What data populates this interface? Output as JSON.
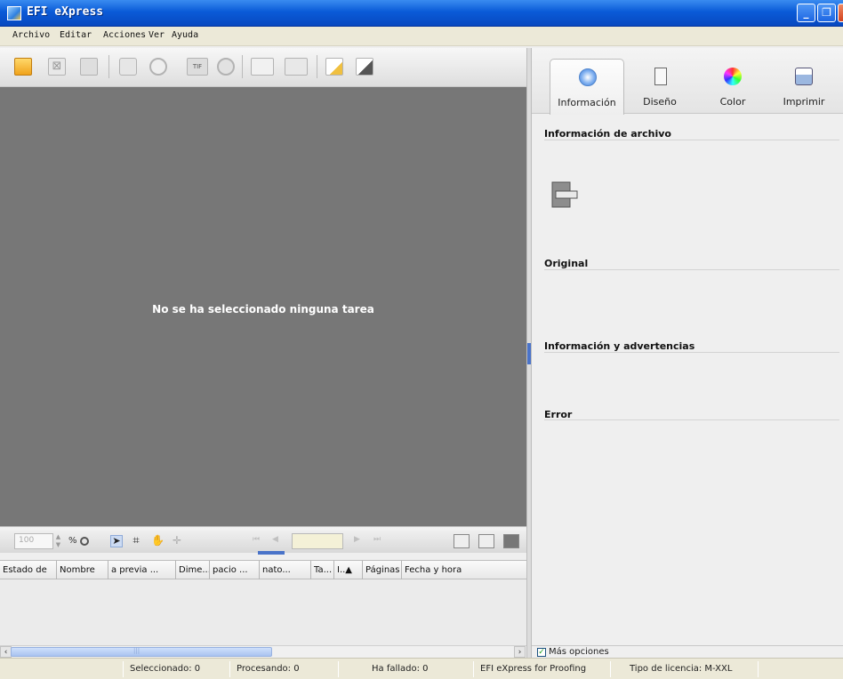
{
  "window": {
    "title": "EFI eXpress"
  },
  "menu": [
    "Archivo",
    "Editar",
    "Acciones",
    "Ver",
    "Ayuda"
  ],
  "preview": {
    "message": "No se ha seleccionado ninguna tarea"
  },
  "viewbar": {
    "zoom_value": "100",
    "zoom_unit": "%"
  },
  "table": {
    "columns": [
      "Estado de",
      "Nombre",
      "a previa ...",
      "Dime...",
      "pacio ...",
      "nato...",
      "Ta...",
      "I..▲",
      "Páginas",
      "Fecha y hora"
    ]
  },
  "right_panel": {
    "tabs": [
      {
        "label": "Información",
        "icon": "info-icon"
      },
      {
        "label": "Diseño",
        "icon": "layout-icon"
      },
      {
        "label": "Color",
        "icon": "color-wheel-icon"
      },
      {
        "label": "Imprimir",
        "icon": "printer-icon"
      }
    ],
    "sections": [
      "Información de archivo",
      "Original",
      "Información y advertencias",
      "Error"
    ],
    "more_options": "Más opciones"
  },
  "status": {
    "selected": "Seleccionado: 0",
    "processing": "Procesando: 0",
    "failed": "Ha fallado: 0",
    "product": "EFI eXpress for Proofing",
    "license": "Tipo de licencia: M-XXL"
  },
  "colors": {
    "titlebar": "#0a5bd8",
    "preview_bg": "#777777",
    "accent": "#4a73c9"
  }
}
